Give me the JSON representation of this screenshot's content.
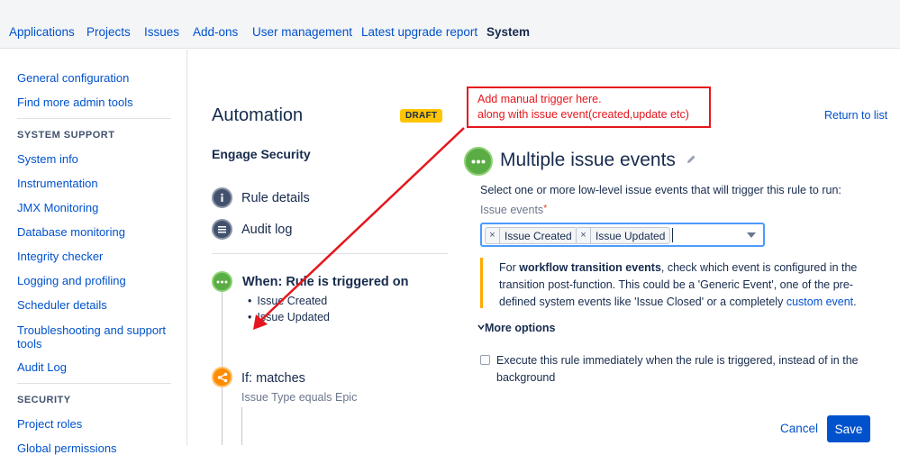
{
  "topnav": {
    "tabs": [
      "Applications",
      "Projects",
      "Issues",
      "Add-ons",
      "User management",
      "Latest upgrade report",
      "System"
    ],
    "active": "System"
  },
  "sidebar": {
    "top_links": [
      "General configuration",
      "Find more admin tools"
    ],
    "system_support_heading": "SYSTEM SUPPORT",
    "system_support_links": [
      "System info",
      "Instrumentation",
      "JMX Monitoring",
      "Database monitoring",
      "Integrity checker",
      "Logging and profiling",
      "Scheduler details",
      "Troubleshooting and support tools",
      "Audit Log"
    ],
    "security_heading": "SECURITY",
    "security_links": [
      "Project roles",
      "Global permissions"
    ]
  },
  "rule": {
    "section_title": "Automation",
    "status_badge": "DRAFT",
    "name": "Engage Security",
    "menu": [
      "Rule details",
      "Audit log"
    ],
    "trigger_title": "When: Rule is triggered on",
    "trigger_events": [
      "Issue Created",
      "Issue Updated"
    ],
    "condition_title": "If: matches",
    "condition_detail": "Issue Type equals Epic"
  },
  "editor": {
    "return_link": "Return to list",
    "component_title": "Multiple issue events",
    "description": "Select one or more low-level issue events that will trigger this rule to run:",
    "field_label": "Issue events",
    "required_mark": "*",
    "selected_events": [
      "Issue Created",
      "Issue Updated"
    ],
    "info_prefix": "For ",
    "info_bold": "workflow transition events",
    "info_middle": ", check which event is configured in the transition post-function. This could be a 'Generic Event', one of the pre-defined system events like 'Issue Closed' or a completely ",
    "info_link": "custom event",
    "info_suffix": ".",
    "more_options": "More options",
    "checkbox_label": "Execute this rule immediately when the rule is triggered, instead of in the background",
    "checkbox_checked": false,
    "cancel_label": "Cancel",
    "save_label": "Save"
  },
  "annotation": {
    "line1": "Add manual trigger here.",
    "line2": "along with issue event(created,update etc)",
    "color": "#e5161d"
  },
  "colors": {
    "link": "#0052cc",
    "trigger_green": "#5aac44",
    "condition_orange": "#ff8b00",
    "draft_yellow": "#ffc400",
    "primary_button": "#0052cc"
  }
}
